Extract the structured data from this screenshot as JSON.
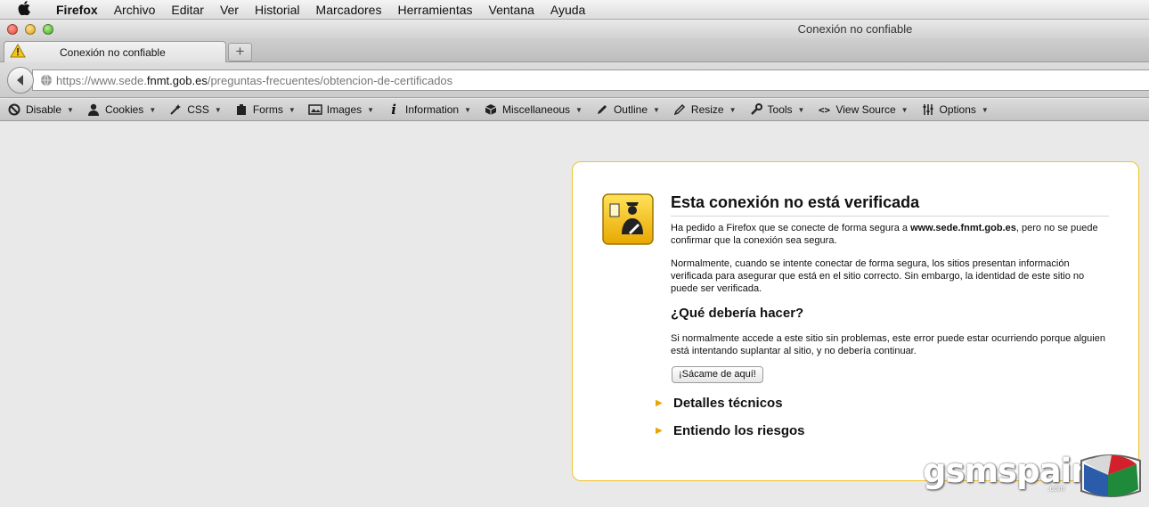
{
  "menubar": {
    "items": [
      {
        "label": "Firefox",
        "bold": true
      },
      {
        "label": "Archivo"
      },
      {
        "label": "Editar"
      },
      {
        "label": "Ver"
      },
      {
        "label": "Historial"
      },
      {
        "label": "Marcadores"
      },
      {
        "label": "Herramientas"
      },
      {
        "label": "Ventana"
      },
      {
        "label": "Ayuda"
      }
    ]
  },
  "window": {
    "title": "Conexión no confiable"
  },
  "tabs": [
    {
      "label": "Conexión no confiable",
      "icon": "warning-icon"
    }
  ],
  "newtab_label": "+",
  "url": {
    "prefix": "https://www.sede.",
    "domain": "fnmt.gob.es",
    "path": "/preguntas-frecuentes/obtencion-de-certificados"
  },
  "devbar": {
    "items": [
      {
        "label": "Disable",
        "icon": "disable-icon"
      },
      {
        "label": "Cookies",
        "icon": "cookies-icon"
      },
      {
        "label": "CSS",
        "icon": "css-icon"
      },
      {
        "label": "Forms",
        "icon": "forms-icon"
      },
      {
        "label": "Images",
        "icon": "images-icon"
      },
      {
        "label": "Information",
        "icon": "information-icon"
      },
      {
        "label": "Miscellaneous",
        "icon": "miscellaneous-icon"
      },
      {
        "label": "Outline",
        "icon": "outline-icon"
      },
      {
        "label": "Resize",
        "icon": "resize-icon"
      },
      {
        "label": "Tools",
        "icon": "tools-icon"
      },
      {
        "label": "View Source",
        "icon": "view-source-icon"
      },
      {
        "label": "Options",
        "icon": "options-icon"
      }
    ]
  },
  "error": {
    "title": "Esta conexión no está verificada",
    "p1_before": "Ha pedido a Firefox que se conecte de forma segura a ",
    "p1_host": "www.sede.fnmt.gob.es",
    "p1_after": ", pero no se puede confirmar que la conexión sea segura.",
    "p2": "Normalmente, cuando se intente conectar de forma segura, los sitios presentan información verificada para asegurar que está en el sitio correcto. Sin embargo, la identidad de este sitio no puede ser verificada.",
    "subhead": "¿Qué debería hacer?",
    "p3": "Si normalmente accede a este sitio sin problemas, este error puede estar ocurriendo porque alguien está intentando suplantar al sitio, y no debería continuar.",
    "button": "¡Sácame de aquí!",
    "expander1": "Detalles técnicos",
    "expander2": "Entiendo los riesgos"
  },
  "watermark": {
    "text": "gsmspain",
    "suffix": ".com"
  },
  "colors": {
    "accent_border": "#f2c230",
    "triangle": "#e6a700",
    "shield_yellow": "#f5c518"
  }
}
